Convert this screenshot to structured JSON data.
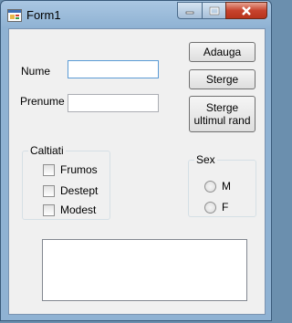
{
  "window": {
    "title": "Form1"
  },
  "fields": {
    "nume_label": "Nume",
    "prenume_label": "Prenume",
    "nume_value": "",
    "prenume_value": ""
  },
  "buttons": {
    "adauga": "Adauga",
    "sterge": "Sterge",
    "sterge_ultimul_line1": "Sterge",
    "sterge_ultimul_line2": "ultimul rand"
  },
  "caltiati": {
    "title": "Caltiati",
    "options": [
      "Frumos",
      "Destept",
      "Modest"
    ]
  },
  "sex": {
    "title": "Sex",
    "options": [
      "M",
      "F"
    ]
  },
  "colors": {
    "title_bar": "#8fb2d3",
    "close_button": "#c7432d",
    "client_bg": "#f0f0f0"
  }
}
